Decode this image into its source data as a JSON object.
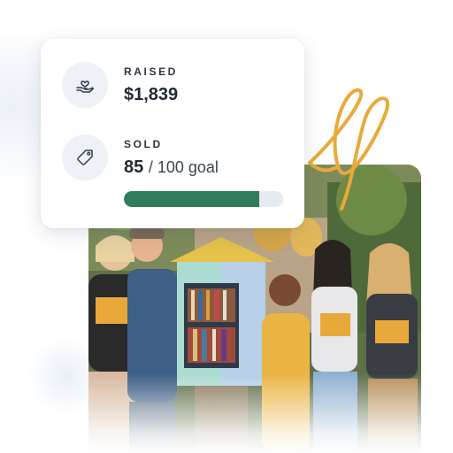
{
  "raised": {
    "label": "RAISED",
    "value": "$1,839",
    "icon": "hand-heart-icon"
  },
  "sold": {
    "label": "SOLD",
    "count": "85",
    "goal_text": "/ 100 goal",
    "icon": "tag-icon",
    "progress_fraction": 0.85
  },
  "colors": {
    "progress_fill": "#2f7d5a",
    "progress_track": "#e6ebf1",
    "swirl": "#e9a93a"
  },
  "photo": {
    "description_icon": "group-photo-image"
  }
}
